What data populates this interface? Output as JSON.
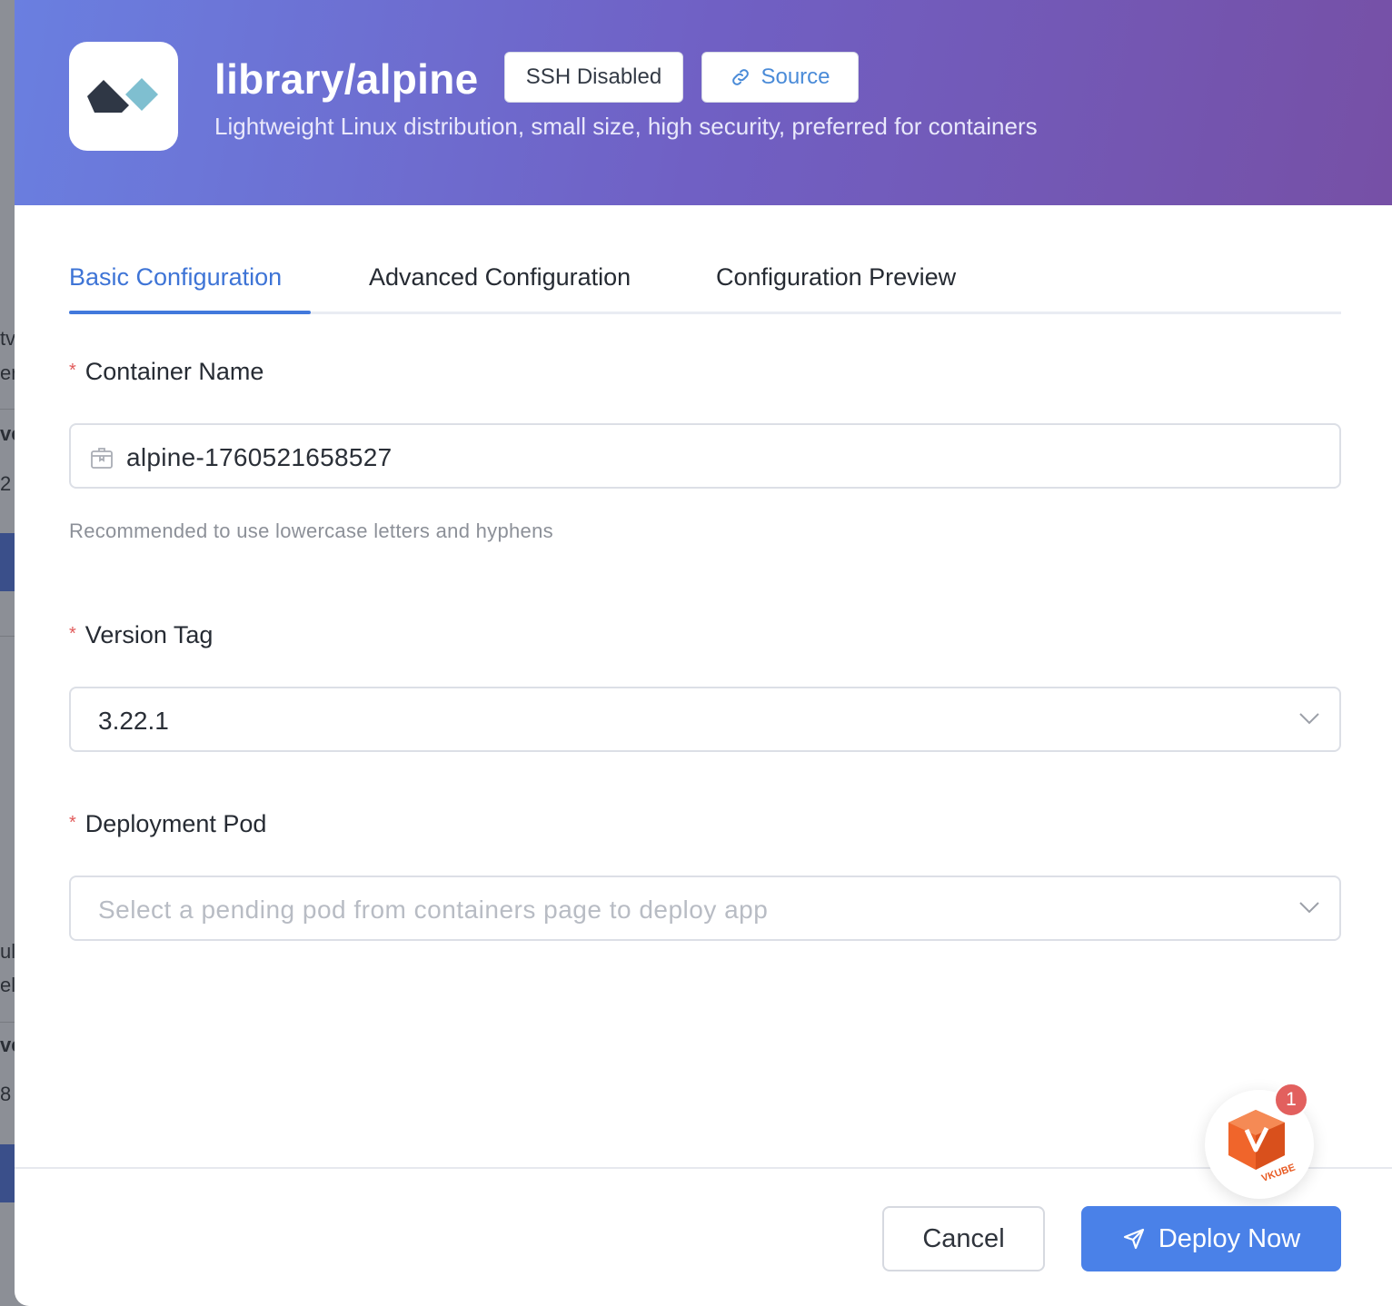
{
  "background": {
    "fragments": [
      "tv",
      "er",
      "ve",
      "2",
      "ul",
      "el",
      "ve",
      "8"
    ]
  },
  "header": {
    "logo_icon": "alpine-logo-icon",
    "title": "library/alpine",
    "ssh_badge": "SSH Disabled",
    "source_link": "Source",
    "description": "Lightweight Linux distribution, small size, high security, preferred for containers"
  },
  "tabs": [
    {
      "label": "Basic Configuration",
      "active": true
    },
    {
      "label": "Advanced Configuration",
      "active": false
    },
    {
      "label": "Configuration Preview",
      "active": false
    }
  ],
  "form": {
    "required_mark": "*",
    "container_name": {
      "label": "Container Name",
      "value": "alpine-1760521658527",
      "hint": "Recommended to use lowercase letters and hyphens"
    },
    "version_tag": {
      "label": "Version Tag",
      "value": "3.22.1"
    },
    "deployment_pod": {
      "label": "Deployment Pod",
      "placeholder": "Select a pending pod from containers page to deploy app"
    }
  },
  "footer": {
    "cancel_label": "Cancel",
    "deploy_label": "Deploy Now"
  },
  "assistant": {
    "notification_count": "1",
    "logo_text": "VKUBE"
  },
  "colors": {
    "accent": "#4a81e8",
    "tab_active": "#3e74d6",
    "required": "#e15a5a",
    "badge": "#e2605e"
  }
}
